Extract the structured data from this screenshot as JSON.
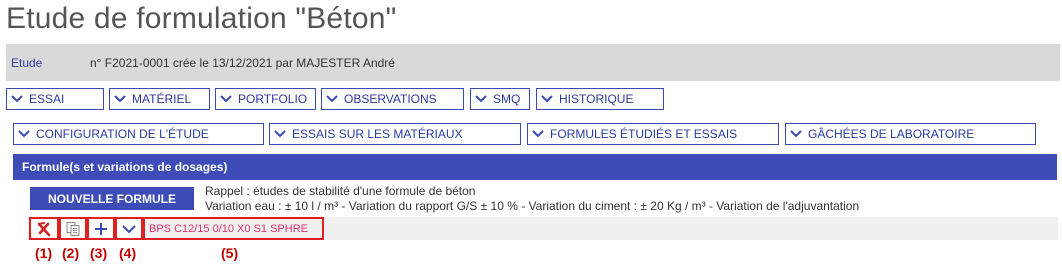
{
  "page": {
    "title": "Etude de formulation \"Béton\""
  },
  "study_bar": {
    "link": "Etude",
    "info": "n° F2021-0001 crée le 13/12/2021 par MAJESTER André"
  },
  "tabs_row1": [
    {
      "label": "ESSAI"
    },
    {
      "label": "MATÉRIEL"
    },
    {
      "label": "PORTFOLIO"
    },
    {
      "label": "OBSERVATIONS"
    },
    {
      "label": "SMQ"
    },
    {
      "label": "HISTORIQUE"
    }
  ],
  "tabs_row2": [
    {
      "label": "CONFIGURATION DE L'ÉTUDE"
    },
    {
      "label": "ESSAIS SUR LES MATÉRIAUX"
    },
    {
      "label": "FORMULES ÉTUDIÉS ET ESSAIS"
    },
    {
      "label": "GÂCHÉES DE LABORATOIRE"
    }
  ],
  "section": {
    "title": "Formule(s et variations de dosages)"
  },
  "new_formula_button": "NOUVELLE FORMULE",
  "rappel": {
    "line1": "Rappel : études de stabilité d'une formule de  béton",
    "line2": "Variation eau : ± 10 l / m³ - Variation du rapport G/S ± 10 % - Variation du ciment :  ± 20 Kg / m³ - Variation de l'adjuvantation"
  },
  "formula_row": {
    "name": "BPS C12/15 0/10 X0 S1 SPHRE"
  },
  "annotations": {
    "a1": "(1)",
    "a2": "(2)",
    "a3": "(3)",
    "a4": "(4)",
    "a5": "(5)"
  },
  "icons": {
    "chevron": "chevron-down-icon",
    "delete": "delete-icon",
    "copy": "copy-icon",
    "add": "plus-icon",
    "expand": "chevron-down-icon"
  },
  "colors": {
    "accent": "#3e4cb8",
    "tab_text": "#2b3aa0",
    "highlight": "#e02020",
    "formula_name": "#e0306a",
    "annotation": "#c00000"
  }
}
